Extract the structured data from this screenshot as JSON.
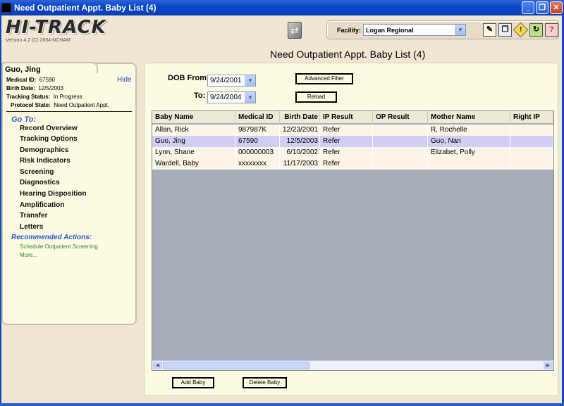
{
  "window": {
    "title": "Need Outpatient Appt. Baby List (4)",
    "buttons": {
      "min": "_",
      "max": "❐",
      "close": "✕"
    }
  },
  "app": {
    "logo": "HI-TRACK",
    "version": "Version 4.2   (C) 2004 NCHAM"
  },
  "facility": {
    "label": "Facility:",
    "value": "Logan Regional"
  },
  "page": {
    "heading": "Need Outpatient Appt. Baby List (4)"
  },
  "patient": {
    "name": "Guo, Jing",
    "hide_label": "Hide",
    "medical_id_label": "Medical ID:",
    "medical_id": "67590",
    "birth_date_label": "Birth Date:",
    "birth_date": "12/5/2003",
    "tracking_status_label": "Tracking Status:",
    "tracking_status": "In Progress",
    "protocol_state_label": "Protocol State:",
    "protocol_state": "Need Outpatient Appt."
  },
  "nav": {
    "goto_label": "Go To:",
    "items": [
      "Record Overview",
      "Tracking Options",
      "Demographics",
      "Risk Indicators",
      "Screening",
      "Diagnostics",
      "Hearing Disposition",
      "Amplification",
      "Transfer",
      "Letters"
    ],
    "recommended_label": "Recommended Actions:",
    "recommended": [
      "Schedule Outpatient Screening",
      "More..."
    ]
  },
  "filters": {
    "dob_from_label": "DOB From:",
    "dob_from": "9/24/2001",
    "to_label": "To:",
    "to": "9/24/2004",
    "advanced_filter": "Advanced Filter",
    "reload": "Reload"
  },
  "table": {
    "columns": [
      "Baby Name",
      "Medical ID",
      "Birth Date",
      "IP Result",
      "OP Result",
      "Mother Name",
      "Right IP"
    ],
    "rows": [
      [
        "Allan, Rick",
        "987987K",
        "12/23/2001",
        "Refer",
        "",
        "R, Rochelle",
        ""
      ],
      [
        "Guo, Jing",
        "67590",
        "12/5/2003",
        "Refer",
        "",
        "Guo, Nan",
        ""
      ],
      [
        "Lynn, Shane",
        "000000003",
        "6/10/2002",
        "Refer",
        "",
        "Elizabet, Polly",
        ""
      ],
      [
        "Wardell, Baby",
        "xxxxxxxx",
        "11/17/2003",
        "Refer",
        "",
        "",
        ""
      ]
    ],
    "selected_row": 1
  },
  "actions": {
    "add_baby": "Add Baby",
    "delete_baby": "Delete Baby"
  }
}
